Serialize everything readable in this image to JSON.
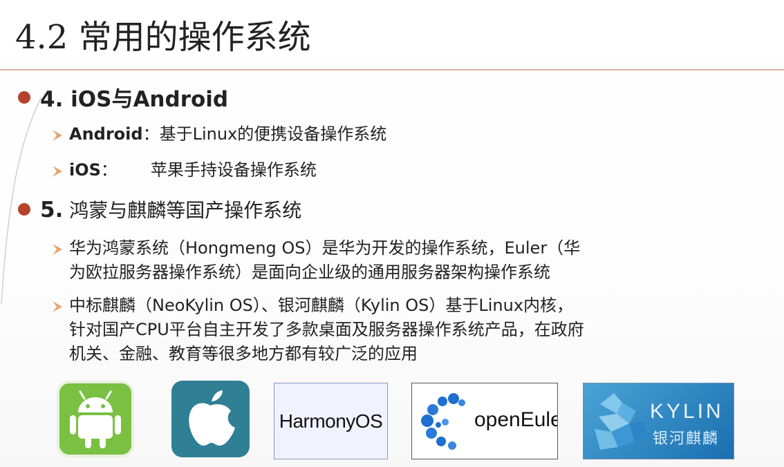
{
  "slide": {
    "title": "4.2 常用的操作系统",
    "sections": [
      {
        "bullet": "4. iOS与Android",
        "items": [
          {
            "label": "Android",
            "text": "：基于Linux的便携设备操作系统"
          },
          {
            "label": "iOS",
            "text": "：",
            "text2": "苹果手持设备操作系统"
          }
        ]
      },
      {
        "bullet_num": "5.",
        "bullet_text": "鸿蒙与麒麟等国产操作系统",
        "items": [
          {
            "line1": "华为鸿蒙系统（Hongmeng OS）是华为开发的操作系统，Euler（华",
            "line2": "为欧拉服务器操作系统）是面向企业级的通用服务器架构操作系统"
          },
          {
            "line1": "中标麒麟（NeoKylin OS）、银河麒麟（Kylin OS）基于Linux内核，",
            "line2": "针对国产CPU平台自主开发了多款桌面及服务器操作系统产品，在政府",
            "line3": "机关、金融、教育等很多地方都有较广泛的应用"
          }
        ]
      }
    ],
    "logos": {
      "android": "android-icon",
      "apple": "apple-icon",
      "harmony_text": "HarmonyOS",
      "euler_text": "openEuler",
      "kylin_text": "KYLIN",
      "kylin_cn": "银河麒麟"
    },
    "colors": {
      "bullet_dot": "#b5432b",
      "arrow": "#e6a36d",
      "title_rule": "#e3b0a4",
      "android_bg": "#7ac043",
      "apple_bg": "#2f7f95",
      "euler_blue": "#1f6fd1"
    }
  }
}
